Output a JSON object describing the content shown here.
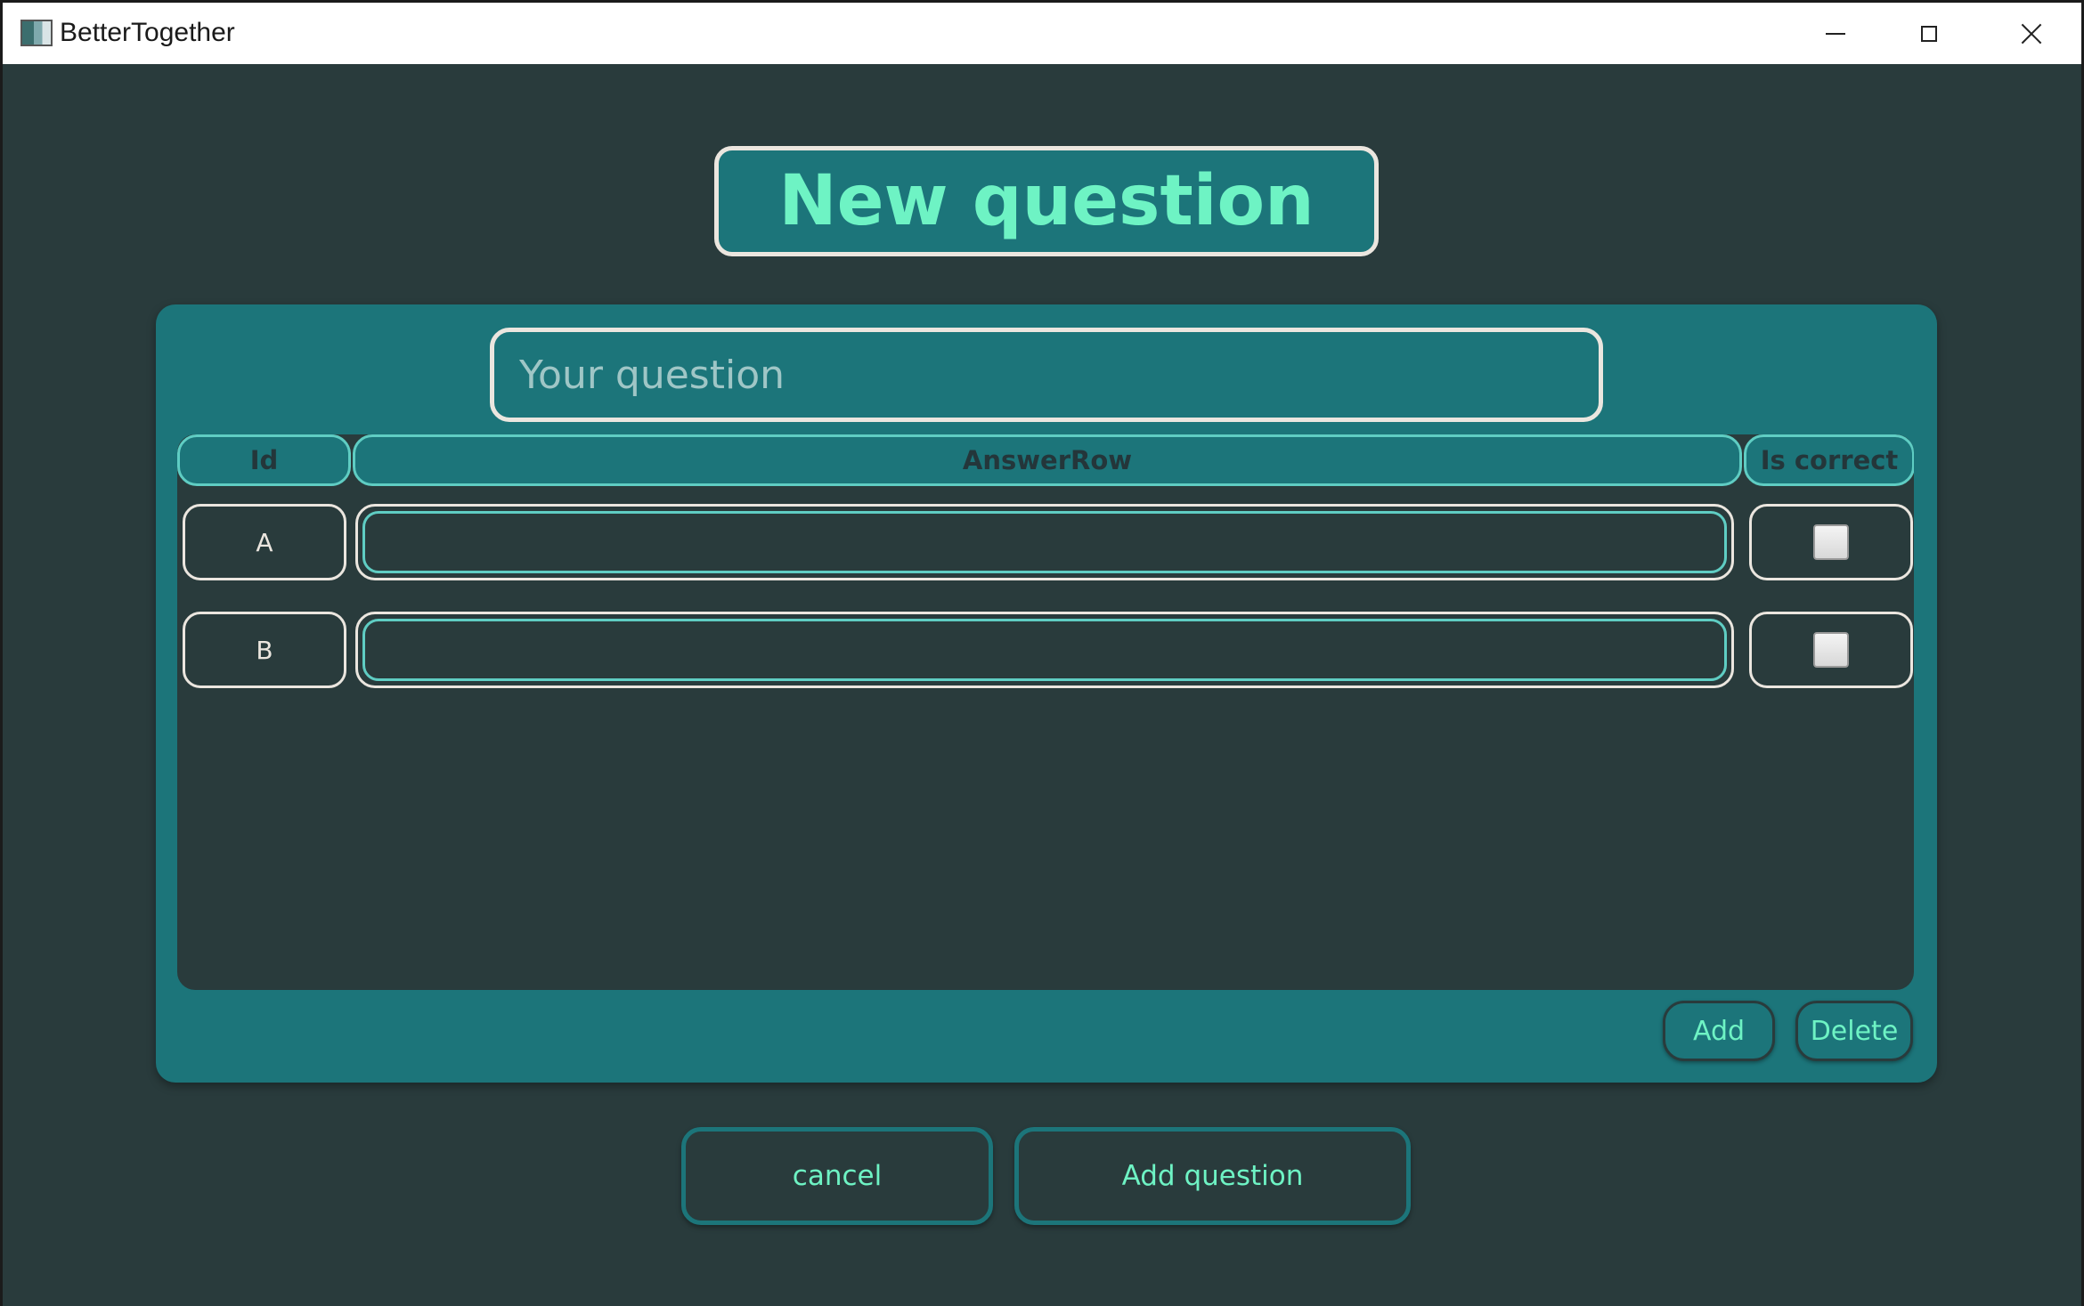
{
  "window": {
    "title": "BetterTogether",
    "controls": [
      "minimize-icon",
      "maximize-icon",
      "close-icon"
    ]
  },
  "header": {
    "title": "New question"
  },
  "question": {
    "value": "",
    "placeholder": "Your question"
  },
  "grid": {
    "columns": [
      "Id",
      "AnswerRow",
      "Is correct"
    ],
    "rows": [
      {
        "id": "A",
        "answer": "",
        "is_correct": false
      },
      {
        "id": "B",
        "answer": "",
        "is_correct": false
      }
    ]
  },
  "grid_actions": {
    "add_label": "Add",
    "delete_label": "Delete"
  },
  "footer": {
    "cancel_label": "cancel",
    "add_question_label": "Add question"
  },
  "colors": {
    "background": "#293b3c",
    "accent_teal": "#1c757a",
    "accent_text": "#6ef3c4",
    "border_light": "#ebe6df",
    "border_teal": "#5fcdc3"
  }
}
